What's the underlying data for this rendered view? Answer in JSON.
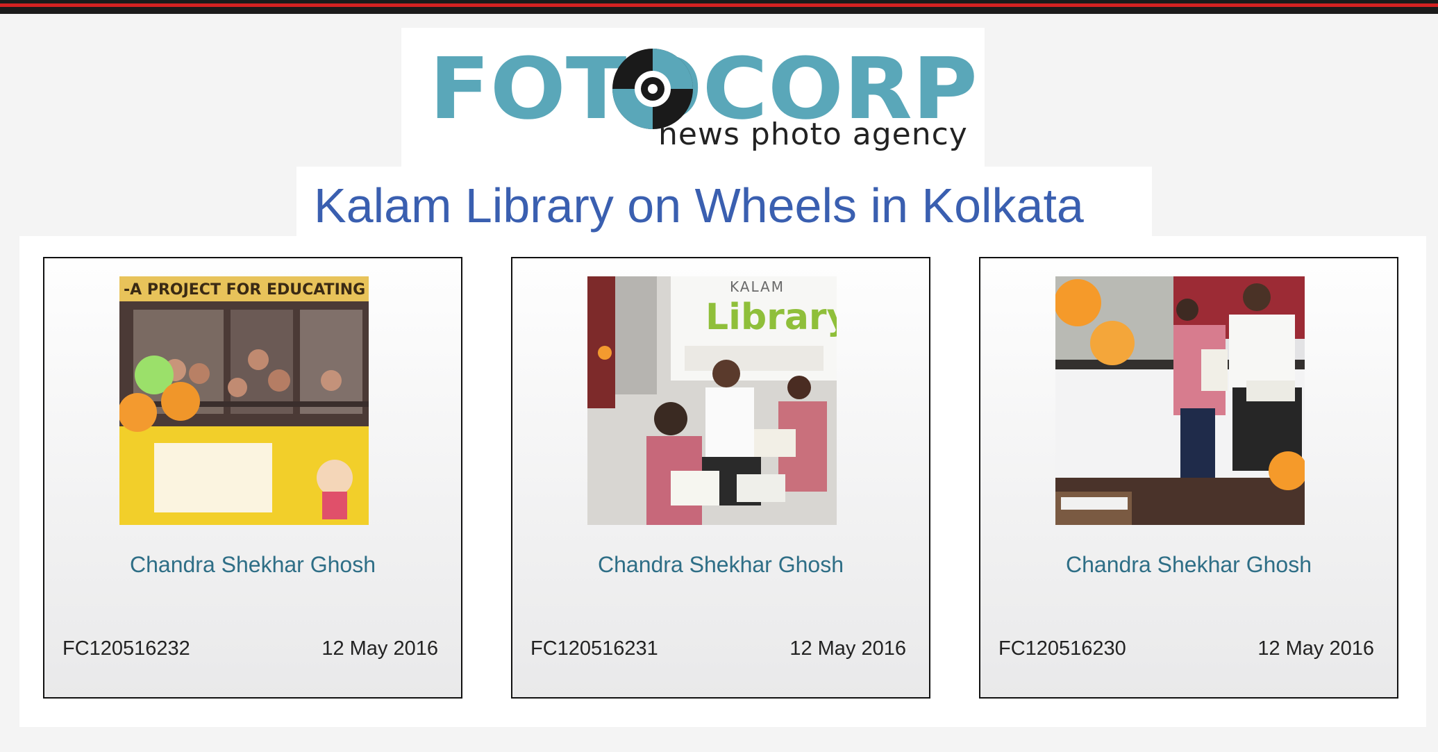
{
  "logo": {
    "wordmark": "FOTOCORP",
    "tagline": "news photo agency",
    "colors": {
      "teal": "#5aa7b9",
      "dark": "#1a1a1a"
    }
  },
  "gallery": {
    "title": "Kalam Library on Wheels in Kolkata",
    "cards": [
      {
        "photographer": "Chandra Shekhar Ghosh",
        "code": "FC120516232",
        "date": "12 May 2016",
        "banner_text": "-A PROJECT FOR EDUCATING S"
      },
      {
        "photographer": "Chandra Shekhar Ghosh",
        "code": "FC120516231",
        "date": "12 May 2016",
        "sign_top": "KALAM",
        "sign_main": "Library"
      },
      {
        "photographer": "Chandra Shekhar Ghosh",
        "code": "FC120516230",
        "date": "12 May 2016"
      }
    ]
  }
}
